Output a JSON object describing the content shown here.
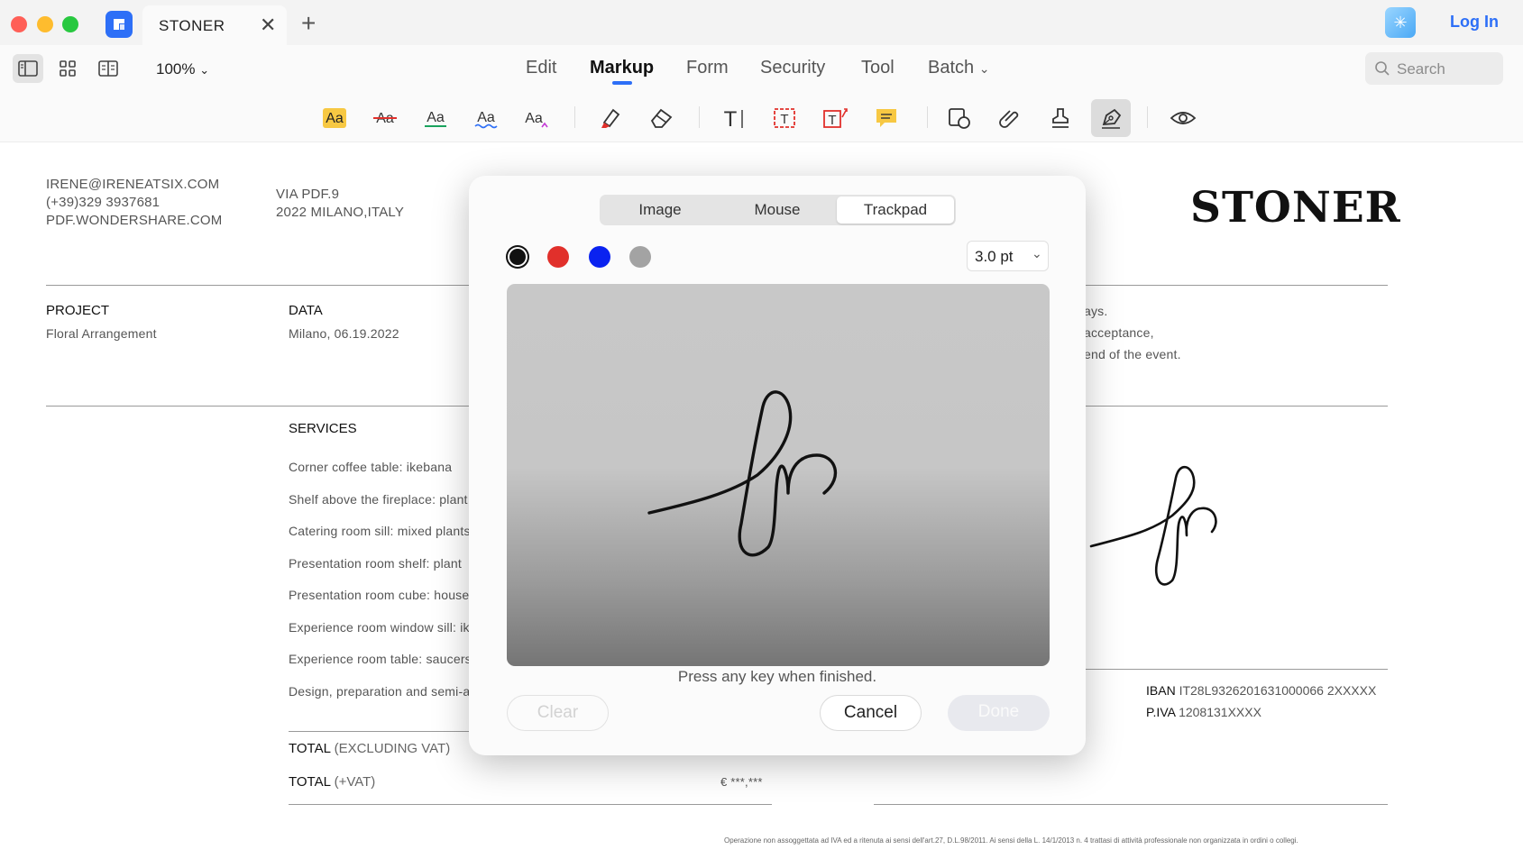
{
  "window": {
    "tab_title": "STONER",
    "login_label": "Log In"
  },
  "toolbar": {
    "zoom": "100%",
    "menus": [
      "Edit",
      "Markup",
      "Form",
      "Security",
      "Tool",
      "Batch"
    ],
    "active_menu": "Markup",
    "search_placeholder": "Search"
  },
  "markup_tools": [
    "highlight-text-icon",
    "strikethrough-text-icon",
    "underline-text-icon",
    "squiggly-underline-text-icon",
    "insert-caret-text-icon",
    "highlighter-pen-icon",
    "eraser-icon",
    "typewriter-icon",
    "textbox-icon",
    "callout-icon",
    "sticky-note-icon",
    "shapes-icon",
    "attachment-icon",
    "stamp-icon",
    "signature-pen-icon",
    "eye-icon"
  ],
  "document": {
    "contact": [
      "IRENE@IRENEATSIX.COM",
      "(+39)329 3937681",
      "PDF.WONDERSHARE.COM"
    ],
    "address": [
      "VIA PDF.9",
      "2022 MILANO,ITALY"
    ],
    "brand": "STONER",
    "project_label": "PROJECT",
    "project_value": "Floral Arrangement",
    "data_label": "DATA",
    "data_value": "Milano, 06.19.2022",
    "terms_fragments": [
      "ays.",
      "acceptance,",
      " end of the event."
    ],
    "services_label": "SERVICES",
    "services": [
      "Corner coffee table: ikebana",
      "Shelf above the fireplace: plant",
      "Catering room sill: mixed plants",
      "Presentation room shelf: plant",
      "Presentation room cube: house",
      "Experience room window sill: ik",
      "Experience room table: saucers",
      "Design, preparation and semi-a"
    ],
    "total_excl_label": "TOTAL",
    "total_excl_note": "(EXCLUDING VAT)",
    "total_vat_label": "TOTAL",
    "total_vat_note": "(+VAT)",
    "total_vat_value": "€ ***,***",
    "iban_label": "IBAN",
    "iban_value": "IT28L9326201631000066 2XXXXX",
    "piva_label": "P.IVA",
    "piva_value": "1208131XXXX",
    "fine_print": "Operazione non assoggettata ad IVA ed a ritenuta ai sensi dell'art.27, D.L.98/2011. Ai sensi della L. 14/1/2013 n. 4 trattasi di attività professionale non organizzata in ordini o collegi."
  },
  "signature_dialog": {
    "tabs": [
      "Image",
      "Mouse",
      "Trackpad"
    ],
    "active_tab": "Trackpad",
    "colors": [
      "#111111",
      "#e1302b",
      "#0a22f0",
      "#a3a3a3"
    ],
    "selected_color": "#111111",
    "stroke_width": "3.0 pt",
    "hint": "Press any key when finished.",
    "clear_label": "Clear",
    "cancel_label": "Cancel",
    "done_label": "Done"
  }
}
